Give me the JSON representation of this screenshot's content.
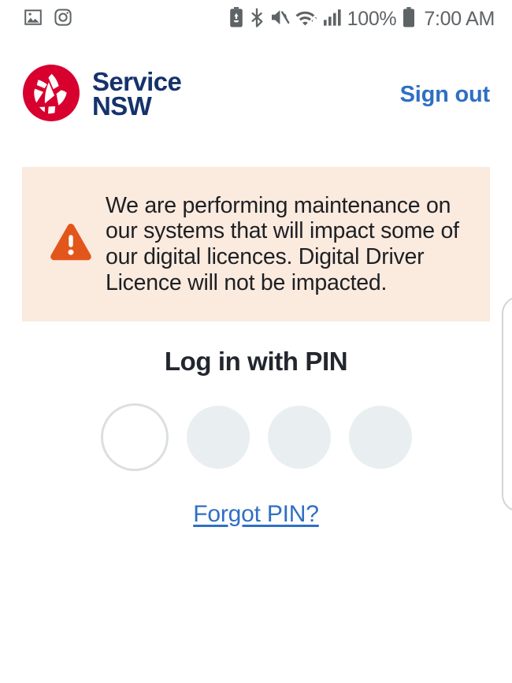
{
  "status_bar": {
    "left_icons": [
      {
        "name": "gallery-icon",
        "label": "Gallery"
      },
      {
        "name": "instagram-icon",
        "label": "Instagram"
      }
    ],
    "right_icons": [
      {
        "name": "battery-saver-icon",
        "label": "Battery saver"
      },
      {
        "name": "bluetooth-icon",
        "label": "Bluetooth"
      },
      {
        "name": "mute-icon",
        "label": "Sound muted"
      },
      {
        "name": "wifi-icon",
        "label": "Wi-Fi"
      },
      {
        "name": "cellular-signal-icon",
        "label": "Mobile signal"
      }
    ],
    "battery_percent": "100%",
    "time": "7:00 AM"
  },
  "header": {
    "brand_line1": "Service",
    "brand_line2": "NSW",
    "sign_out_label": "Sign out",
    "brand_color": "#15326b",
    "logo_color": "#d7002e",
    "link_color": "#2f6fc4"
  },
  "alert": {
    "icon": "warning-triangle-icon",
    "message": "We are performing maintenance on our systems that will impact some of our digital licences. Digital Driver Licence will not be impacted.",
    "background_color": "#fbeade",
    "icon_color": "#e2561c"
  },
  "pin": {
    "title": "Log in with PIN",
    "digits_count": 4,
    "digits_entered": 0,
    "active_index": 0,
    "dot_fill_color": "#e9eef0",
    "dot_active_border_color": "#dcdfe1",
    "forgot_label": "Forgot PIN?"
  }
}
